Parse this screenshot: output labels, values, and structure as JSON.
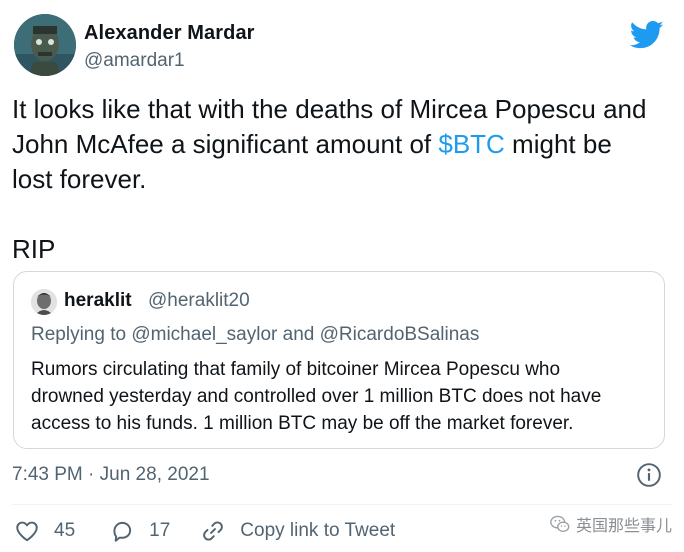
{
  "author": {
    "name": "Alexander Mardar",
    "handle": "@amardar1"
  },
  "tweet": {
    "text_line1": "It looks like that with the deaths of Mircea Popescu and",
    "text_line2_before": "John McAfee a significant amount of ",
    "text_line2_cashtag": "$BTC",
    "text_line2_after": " might be",
    "text_line3": "lost forever.",
    "text_line4": "RIP"
  },
  "quoted_tweet": {
    "name": "heraklit",
    "handle": "@heraklit20",
    "replying_prefix": "Replying to ",
    "replying_user1": "@michael_saylor",
    "replying_and": " and ",
    "replying_user2": "@RicardoBSalinas",
    "text_line1": "Rumors circulating that family of bitcoiner Mircea Popescu who",
    "text_line2": "drowned yesterday and controlled over 1 million BTC does not have",
    "text_line3": "access to his funds. 1 million BTC may be off the market forever."
  },
  "meta": {
    "timestamp": "7:43 PM · Jun 28, 2021"
  },
  "actions": {
    "like_count": "45",
    "reply_count": "17",
    "copy_link_label": "Copy link to Tweet"
  },
  "watermark": {
    "text": "英国那些事儿"
  },
  "icons": {
    "brand": "twitter-bird-icon",
    "info": "info-icon",
    "like": "heart-icon",
    "reply": "comment-icon",
    "share": "link-icon",
    "watermark": "wechat-icon"
  },
  "colors": {
    "text": "#0f1419",
    "secondary": "#536471",
    "accent": "#1d9bf0",
    "border": "#cfd9de"
  }
}
